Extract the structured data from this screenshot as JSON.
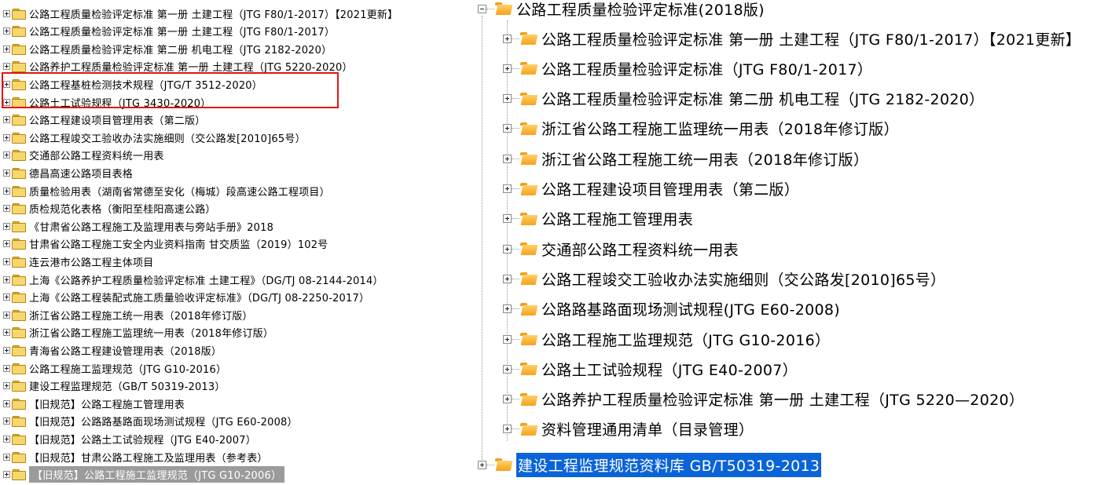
{
  "left_tree": {
    "items": [
      {
        "label": "公路工程质量检验评定标准 第一册 土建工程（JTG F80/1-2017）【2021更新】"
      },
      {
        "label": "公路工程质量检验评定标准 第一册 土建工程（JTG F80/1-2017）"
      },
      {
        "label": "公路工程质量检验评定标准 第二册 机电工程（JTG 2182-2020）"
      },
      {
        "label": "公路养护工程质量检验评定标准 第一册 土建工程（JTG 5220-2020）"
      },
      {
        "label": "公路工程基桩检测技术规程（JTG/T 3512-2020）"
      },
      {
        "label": "公路土工试验规程（JTG 3430-2020）"
      },
      {
        "label": "公路工程建设项目管理用表（第二版）"
      },
      {
        "label": "公路工程竣交工验收办法实施细则（交公路发[2010]65号）"
      },
      {
        "label": "交通部公路工程资料统一用表"
      },
      {
        "label": "德昌高速公路项目表格"
      },
      {
        "label": "质量检验用表（湖南省常德至安化（梅城）段高速公路工程项目）"
      },
      {
        "label": "质检规范化表格（衡阳至桂阳高速公路）"
      },
      {
        "label": "《甘肃省公路工程施工及监理用表与旁站手册》2018"
      },
      {
        "label": "甘肃省公路工程施工安全内业资料指南 甘交质监（2019）102号"
      },
      {
        "label": "连云港市公路工程主体项目"
      },
      {
        "label": "上海《公路养护工程质量检验评定标准 土建工程》（DG/TJ 08-2144-2014）"
      },
      {
        "label": "上海《公路工程装配式施工质量验收评定标准》（DG/TJ 08-2250-2017）"
      },
      {
        "label": "浙江省公路工程施工统一用表（2018年修订版）"
      },
      {
        "label": "浙江省公路工程施工监理统一用表（2018年修订版）"
      },
      {
        "label": "青海省公路工程建设管理用表（2018版）"
      },
      {
        "label": "公路工程施工监理规范（JTG G10-2016）"
      },
      {
        "label": "建设工程监理规范（GB/T 50319-2013）"
      },
      {
        "label": "【旧规范】公路工程施工管理用表"
      },
      {
        "label": "【旧规范】公路路基路面现场测试规程（JTG E60-2008）"
      },
      {
        "label": "【旧规范】公路土工试验规程（JTG E40-2007）"
      },
      {
        "label": "【旧规范】甘肃公路工程施工及监理用表（参考表）"
      },
      {
        "label": "【旧规范】公路工程施工监理规范（JTG G10-2006）"
      }
    ],
    "selected_index": 26,
    "highlight_color": "#e01515"
  },
  "right_tree": {
    "root_label": "公路工程质量检验评定标准(2018版)",
    "children": [
      {
        "label": "公路工程质量检验评定标准 第一册 土建工程（JTG F80/1-2017）【2021更新】"
      },
      {
        "label": "公路工程质量检验评定标准（JTG F80/1-2017）"
      },
      {
        "label": "公路工程质量检验评定标准 第二册 机电工程（JTG 2182-2020）"
      },
      {
        "label": "浙江省公路工程施工监理统一用表（2018年修订版）"
      },
      {
        "label": "浙江省公路工程施工统一用表（2018年修订版）"
      },
      {
        "label": "公路工程建设项目管理用表（第二版）"
      },
      {
        "label": "公路工程施工管理用表"
      },
      {
        "label": "交通部公路工程资料统一用表"
      },
      {
        "label": "公路工程竣交工验收办法实施细则（交公路发[2010]65号）"
      },
      {
        "label": "公路路基路面现场测试规程(JTG E60-2008)"
      },
      {
        "label": "公路工程施工监理规范（JTG G10-2016）"
      },
      {
        "label": "公路土工试验规程（JTG E40-2007）"
      },
      {
        "label": "公路养护工程质量检验评定标准 第一册 土建工程（JTG 5220—2020）"
      },
      {
        "label": "资料管理通用清单（目录管理）"
      }
    ],
    "sibling_label": "建设工程监理规范资料库 GB/T50319-2013",
    "selected_color": "#0a64d8"
  }
}
